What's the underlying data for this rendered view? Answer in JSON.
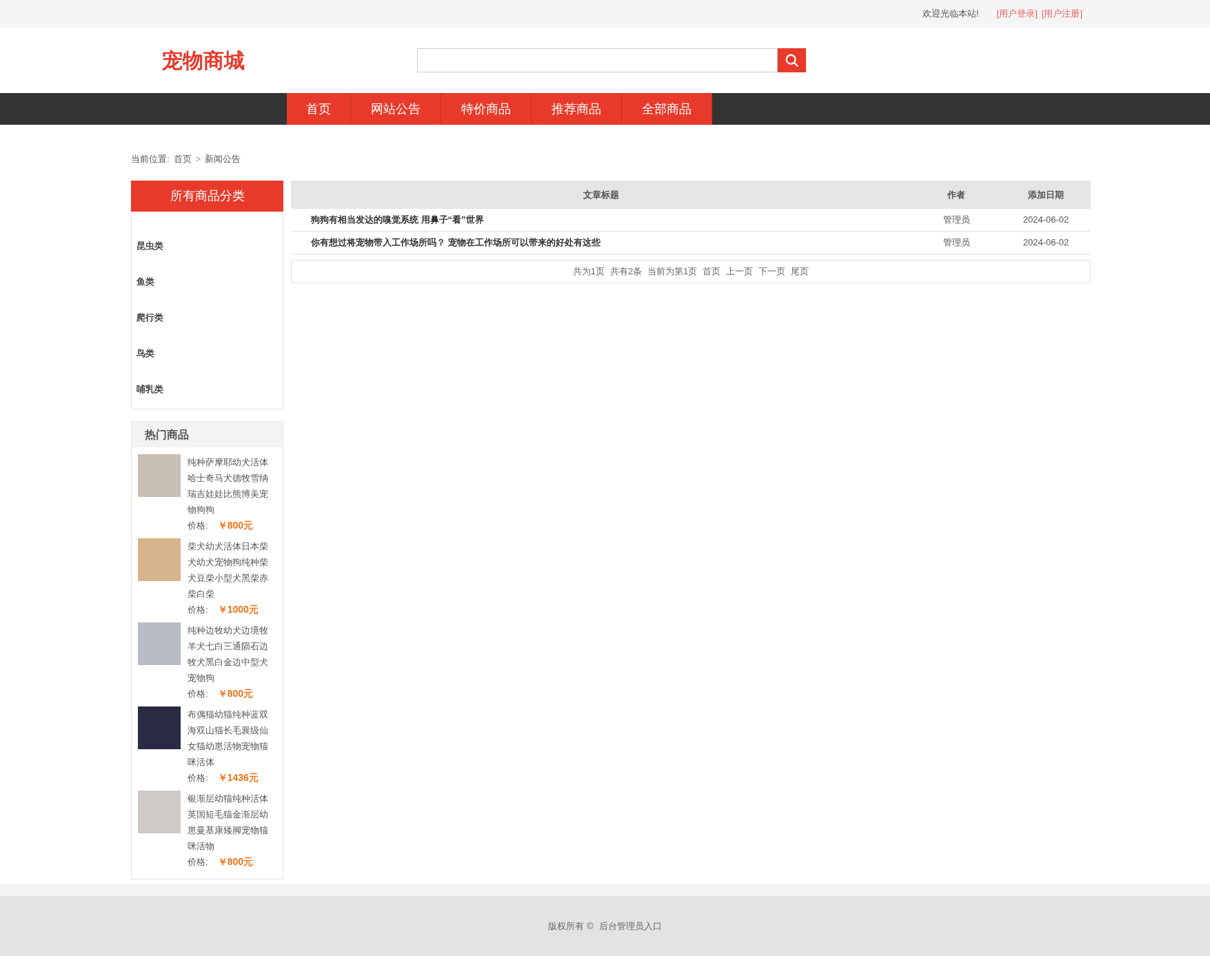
{
  "top_bar": {
    "welcome": "欢迎光临本站!",
    "links": [
      "[用户登录]",
      "[用户注册]"
    ]
  },
  "header": {
    "logo": "宠物商城"
  },
  "nav": [
    {
      "label": "首页"
    },
    {
      "label": "网站公告"
    },
    {
      "label": "特价商品"
    },
    {
      "label": "推荐商品"
    },
    {
      "label": "全部商品"
    }
  ],
  "breadcrumb": {
    "prefix": "当前位置:",
    "items": [
      "首页",
      "新闻公告"
    ],
    "separator": ">"
  },
  "categories": {
    "title": "所有商品分类",
    "items": [
      "昆虫类",
      "鱼类",
      "爬行类",
      "鸟类",
      "哺乳类"
    ]
  },
  "hot": {
    "title": "热门商品",
    "items": [
      {
        "name": "纯种萨摩耶幼犬活体哈士奇马犬德牧雪纳瑞吉娃娃比熊博美宠物狗狗",
        "price_label": "价格:",
        "price": "￥800元"
      },
      {
        "name": "柴犬幼犬活体日本柴犬幼犬宠物狗纯种柴犬豆柴小型犬黑柴赤柴白柴",
        "price_label": "价格:",
        "price": "￥1000元"
      },
      {
        "name": "纯种边牧幼犬边境牧羊犬七白三通陨石边牧犬黑白金边中型犬宠物狗",
        "price_label": "价格:",
        "price": "￥800元"
      },
      {
        "name": "布偶猫幼猫纯种蓝双海双山猫长毛襄级仙女猫幼崽活物宠物猫咪活体",
        "price_label": "价格:",
        "price": "￥1436元"
      },
      {
        "name": "银渐层幼猫纯种活体英国短毛猫金渐层幼崽曼基康矮脚宠物猫咪活物",
        "price_label": "价格:",
        "price": "￥800元"
      }
    ]
  },
  "table": {
    "columns": [
      "文章标题",
      "作者",
      "添加日期"
    ],
    "rows": [
      [
        "狗狗有相当发达的嗅觉系统 用鼻子“看”世界",
        "管理员",
        "2024-06-02"
      ],
      [
        "你有想过将宠物带入工作场所吗？ 宠物在工作场所可以带来的好处有这些",
        "管理员",
        "2024-06-02"
      ]
    ]
  },
  "pagination": {
    "info": [
      "共为1页",
      "共有2条",
      "当前为第1页"
    ],
    "links": [
      "首页",
      "上一页",
      "下一页",
      "尾页"
    ]
  },
  "footer": {
    "copyright": "版权所有 ©",
    "admin_link": "后台管理员入口"
  }
}
